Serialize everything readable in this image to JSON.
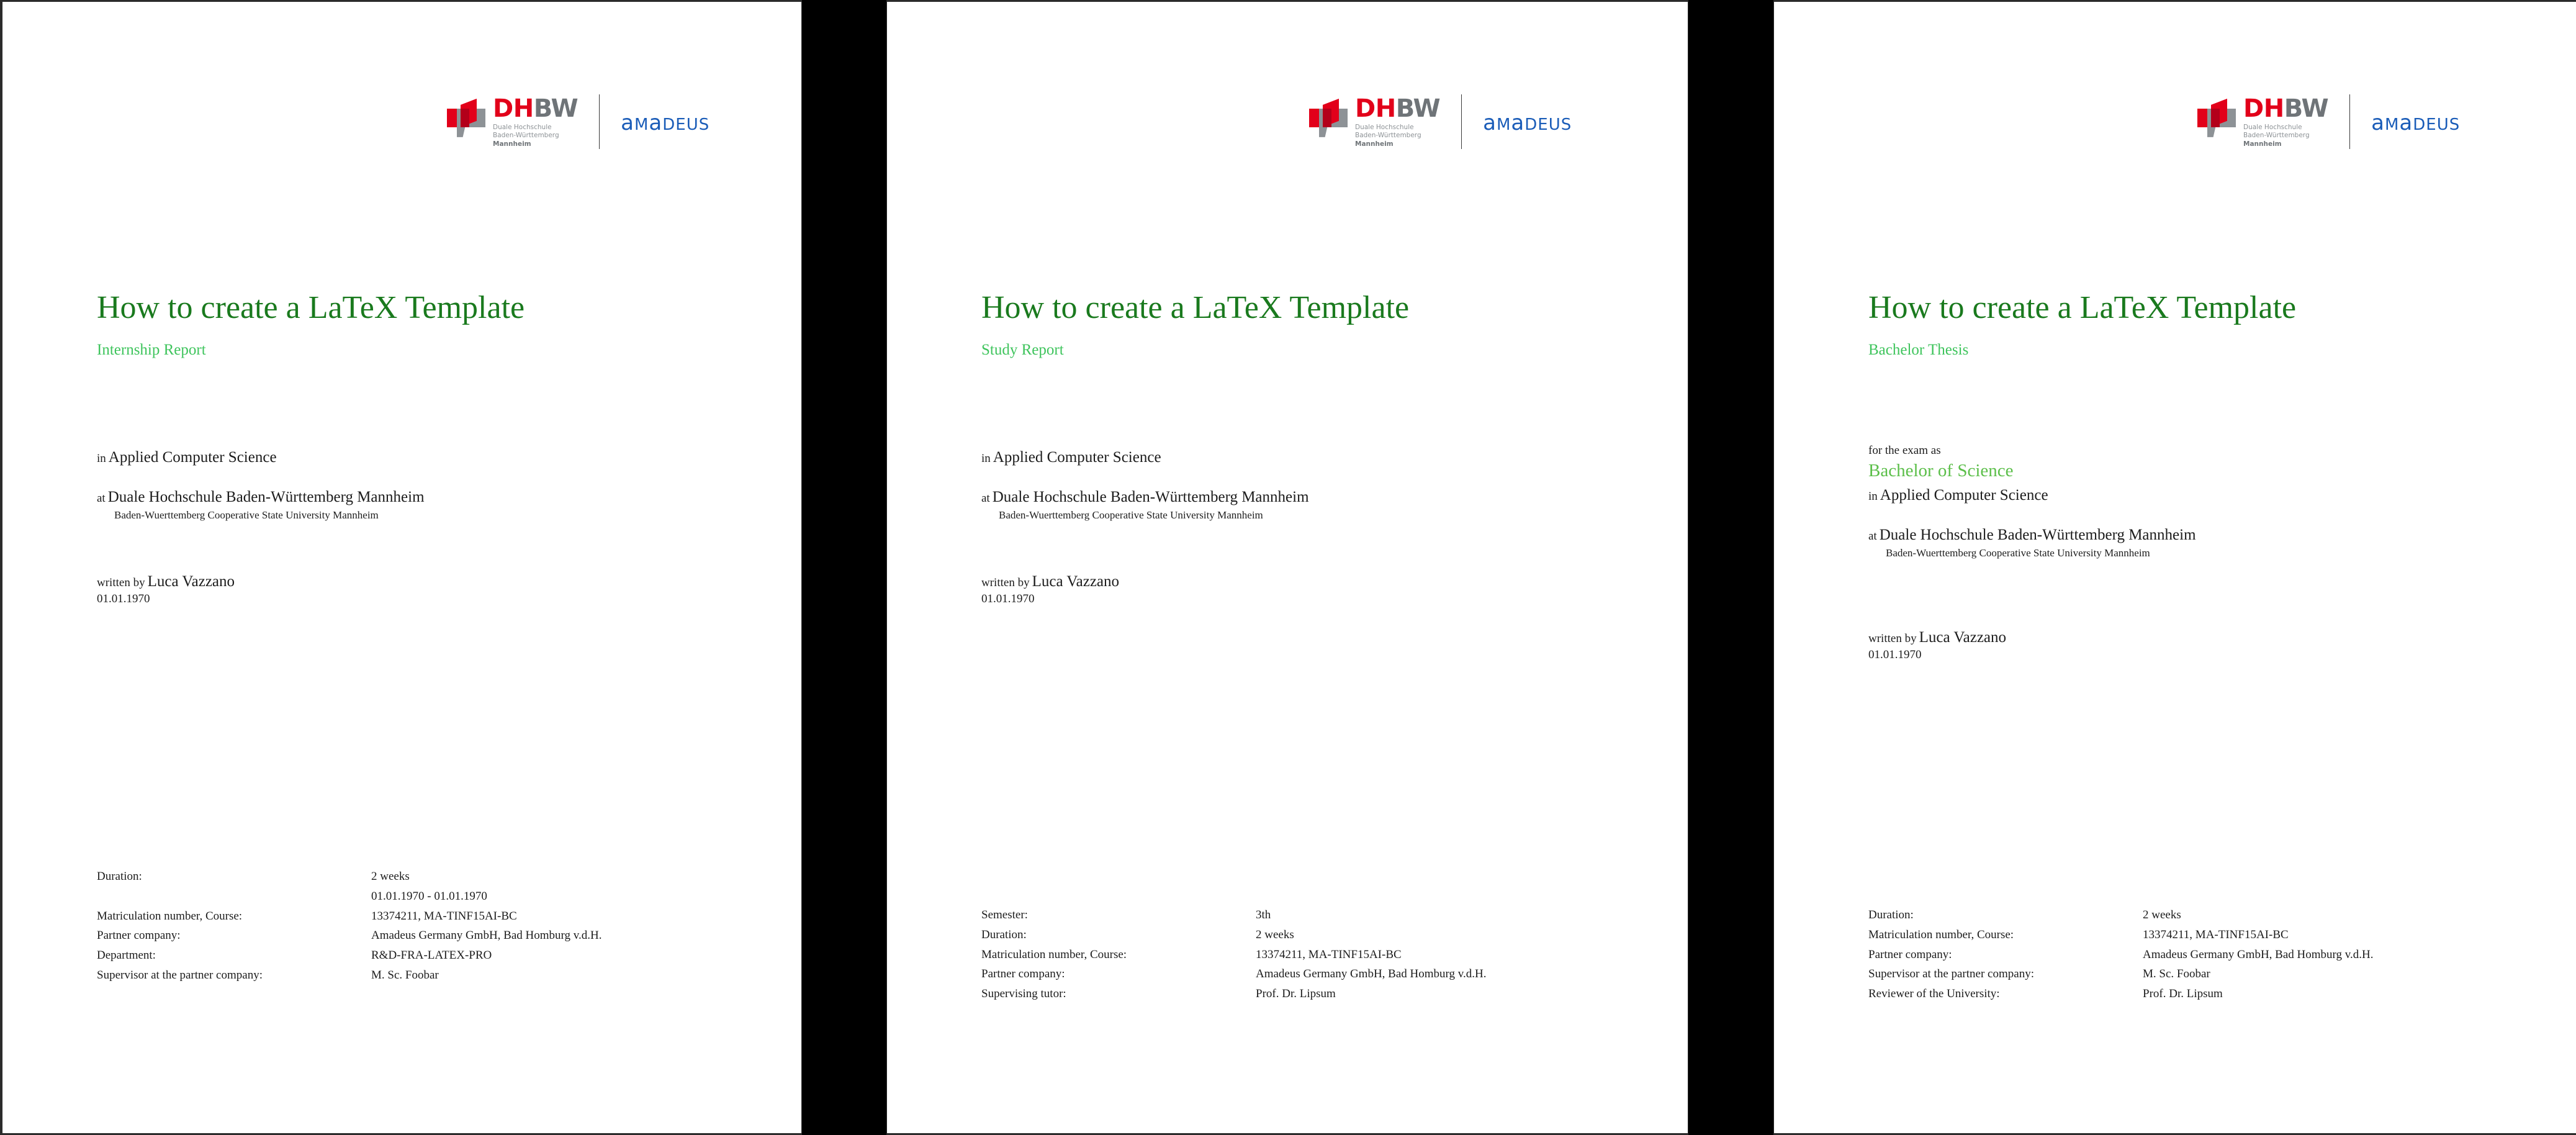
{
  "logo": {
    "dhbw_dh": "DH",
    "dhbw_bw": "BW",
    "dhbw_sub_line1": "Duale Hochschule",
    "dhbw_sub_line2": "Baden-Württemberg",
    "dhbw_city": "Mannheim",
    "partner_wordmark": "amadeus",
    "colors": {
      "dhbw_red": "#e2001a",
      "dhbw_gray": "#8d9296",
      "amadeus_blue": "#1a5cb8"
    }
  },
  "theme": {
    "title_green": "#1a7a1e",
    "subtitle_green": "#3ec45c",
    "degree_green": "#5cbf4a",
    "body_black": "#1c1c1c"
  },
  "common": {
    "title": "How to create a LaTeX Template",
    "in_label": "in",
    "field_of_study": "Applied Computer Science",
    "at_label": "at",
    "university_de": "Duale Hochschule Baden-Württemberg Mannheim",
    "university_en": "Baden-Wuerttemberg Cooperative State University Mannheim",
    "written_by_label": "written by",
    "author": "Luca Vazzano",
    "date": "01.01.1970",
    "for_the_exam_as_label": "for the exam as"
  },
  "pages": [
    {
      "id": "page-internship-report",
      "subtitle": "Internship Report",
      "has_degree": false,
      "degree": "",
      "meta": [
        {
          "key": "Duration:",
          "value": "2 weeks",
          "extra": "01.01.1970 - 01.01.1970"
        },
        {
          "key": "Matriculation number, Course:",
          "value": "13374211, MA-TINF15AI-BC",
          "extra": ""
        },
        {
          "key": "Partner company:",
          "value": "Amadeus Germany GmbH, Bad Homburg v.d.H.",
          "extra": ""
        },
        {
          "key": "Department:",
          "value": "R&D-FRA-LATEX-PRO",
          "extra": ""
        },
        {
          "key": "Supervisor at the partner company:",
          "value": "M. Sc. Foobar",
          "extra": ""
        }
      ]
    },
    {
      "id": "page-study-report",
      "subtitle": "Study Report",
      "has_degree": false,
      "degree": "",
      "meta": [
        {
          "key": "Semester:",
          "value": "3th",
          "extra": ""
        },
        {
          "key": "Duration:",
          "value": "2 weeks",
          "extra": ""
        },
        {
          "key": "Matriculation number, Course:",
          "value": "13374211, MA-TINF15AI-BC",
          "extra": ""
        },
        {
          "key": "Partner company:",
          "value": "Amadeus Germany GmbH, Bad Homburg v.d.H.",
          "extra": ""
        },
        {
          "key": "Supervising tutor:",
          "value": "Prof. Dr. Lipsum",
          "extra": ""
        }
      ]
    },
    {
      "id": "page-bachelor-thesis",
      "subtitle": "Bachelor Thesis",
      "has_degree": true,
      "degree": "Bachelor of Science",
      "meta": [
        {
          "key": "Duration:",
          "value": "2 weeks",
          "extra": ""
        },
        {
          "key": "Matriculation number, Course:",
          "value": "13374211, MA-TINF15AI-BC",
          "extra": ""
        },
        {
          "key": "Partner company:",
          "value": "Amadeus Germany GmbH, Bad Homburg v.d.H.",
          "extra": ""
        },
        {
          "key": "Supervisor at the partner company:",
          "value": "M. Sc. Foobar",
          "extra": ""
        },
        {
          "key": "Reviewer of the University:",
          "value": "Prof. Dr. Lipsum",
          "extra": ""
        }
      ]
    }
  ]
}
